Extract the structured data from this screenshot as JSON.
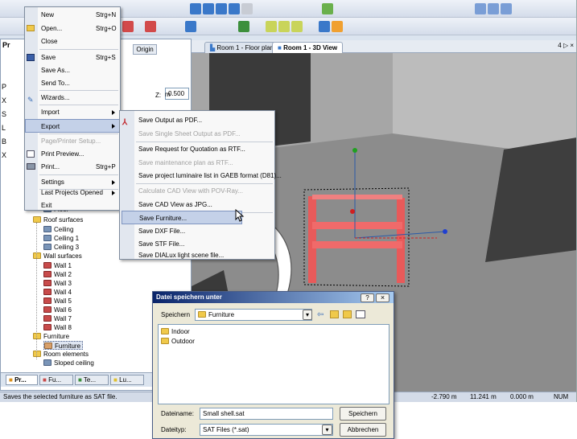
{
  "view_tabs": [
    "Room 1 - Floor plan",
    "Room 1 - 3D View"
  ],
  "panel": {
    "tab_origin": "Origin",
    "z_label": "Z:",
    "z_value": "0.500",
    "z_unit": "m",
    "left_letters": [
      "P",
      "X",
      "S",
      "L",
      "B",
      "X"
    ]
  },
  "file_menu": {
    "items": [
      {
        "label": "New",
        "accel": "Strg+N"
      },
      {
        "label": "Open...",
        "accel": "Strg+O"
      },
      {
        "label": "Close",
        "accel": ""
      },
      {
        "label": "Save",
        "accel": "Strg+S"
      },
      {
        "label": "Save As...",
        "accel": ""
      },
      {
        "label": "Send To...",
        "accel": ""
      },
      {
        "label": "Wizards...",
        "accel": ""
      },
      {
        "label": "Import",
        "accel": ""
      },
      {
        "label": "Export",
        "accel": ""
      },
      {
        "label": "Page/Printer Setup...",
        "accel": ""
      },
      {
        "label": "Print Preview...",
        "accel": ""
      },
      {
        "label": "Print...",
        "accel": "Strg+P"
      },
      {
        "label": "Settings",
        "accel": ""
      },
      {
        "label": "Last Projects Opened",
        "accel": ""
      },
      {
        "label": "Exit",
        "accel": ""
      }
    ]
  },
  "export_menu": {
    "items": [
      "Save Output as PDF...",
      "Save Single Sheet Output as PDF...",
      "Save Request for Quotation as RTF...",
      "Save maintenance plan as RTF...",
      "Save project luminaire list in GAEB format (D81)...",
      "Calculate CAD View with POV-Ray...",
      "Save CAD View as JPG...",
      "Save Furniture...",
      "Save DXF File...",
      "Save STF File...",
      "Save DIALux light scene file..."
    ]
  },
  "tree": {
    "items": [
      {
        "label": "Floor",
        "icon": "floor-icon"
      },
      {
        "label": "Roof surfaces",
        "icon": "folder-icon"
      },
      {
        "label": "Ceiling",
        "icon": "ceiling-icon"
      },
      {
        "label": "Ceiling 1",
        "icon": "ceiling-icon"
      },
      {
        "label": "Ceiling 3",
        "icon": "ceiling-icon"
      },
      {
        "label": "Wall surfaces",
        "icon": "folder-icon"
      },
      {
        "label": "Wall 1",
        "icon": "wall-icon"
      },
      {
        "label": "Wall 2",
        "icon": "wall-icon"
      },
      {
        "label": "Wall 3",
        "icon": "wall-icon"
      },
      {
        "label": "Wall 4",
        "icon": "wall-icon"
      },
      {
        "label": "Wall 5",
        "icon": "wall-icon"
      },
      {
        "label": "Wall 6",
        "icon": "wall-icon"
      },
      {
        "label": "Wall 7",
        "icon": "wall-icon"
      },
      {
        "label": "Wall 8",
        "icon": "wall-icon"
      },
      {
        "label": "Furniture",
        "icon": "folder-icon"
      },
      {
        "label": "Furniture",
        "icon": "furniture-icon"
      },
      {
        "label": "Room elements",
        "icon": "folder-icon"
      },
      {
        "label": "Sloped ceiling",
        "icon": "ceiling-icon"
      }
    ]
  },
  "bottom_tabs": [
    "Pr...",
    "Fu...",
    "Te...",
    "Lu..."
  ],
  "status": {
    "message": "Saves the selected furniture as SAT file.",
    "x": "-2.790 m",
    "y": "11.241 m",
    "z": "0.000 m",
    "mode": "NUM"
  },
  "dialog": {
    "title": "Datei speichern unter",
    "save_in_label": "Speichern",
    "save_in_value": "Furniture",
    "folders": [
      "Indoor",
      "Outdoor"
    ],
    "filename_label": "Dateiname:",
    "filename_value": "Small shell.sat",
    "filetype_label": "Dateityp:",
    "filetype_value": "SAT Files (*.sat)",
    "save_button": "Speichern",
    "cancel_button": "Abbrechen",
    "help": "?",
    "close": "×"
  },
  "window_controls": "4 ▷ ×",
  "pr_label": "Pr"
}
